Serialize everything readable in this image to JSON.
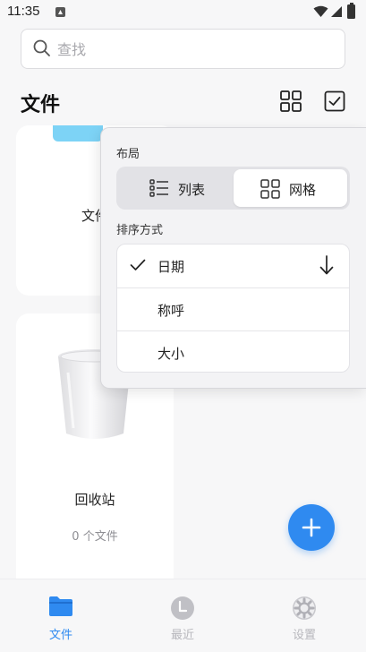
{
  "status_bar": {
    "time": "11:35"
  },
  "search": {
    "placeholder": "查找"
  },
  "header": {
    "title": "文件"
  },
  "cards": {
    "docs": {
      "label": "文件"
    },
    "trash": {
      "label": "回收站",
      "count": "0 个文件"
    }
  },
  "popover": {
    "layout_label": "布局",
    "layout_options": [
      {
        "label": "列表",
        "icon": "list-icon",
        "selected": false
      },
      {
        "label": "网格",
        "icon": "grid-icon",
        "selected": true
      }
    ],
    "sort_label": "排序方式",
    "sort_options": [
      {
        "label": "日期",
        "checked": true,
        "direction": "descending"
      },
      {
        "label": "称呼",
        "checked": false
      },
      {
        "label": "大小",
        "checked": false
      }
    ]
  },
  "bottom_nav": {
    "items": [
      {
        "label": "文件",
        "icon": "folder-icon",
        "active": true
      },
      {
        "label": "最近",
        "icon": "clock-icon",
        "active": false
      },
      {
        "label": "设置",
        "icon": "gear-icon",
        "active": false
      }
    ]
  },
  "colors": {
    "accent": "#2f8af0",
    "folder": "#7dd3f6",
    "inactive": "#b7b7bc"
  }
}
